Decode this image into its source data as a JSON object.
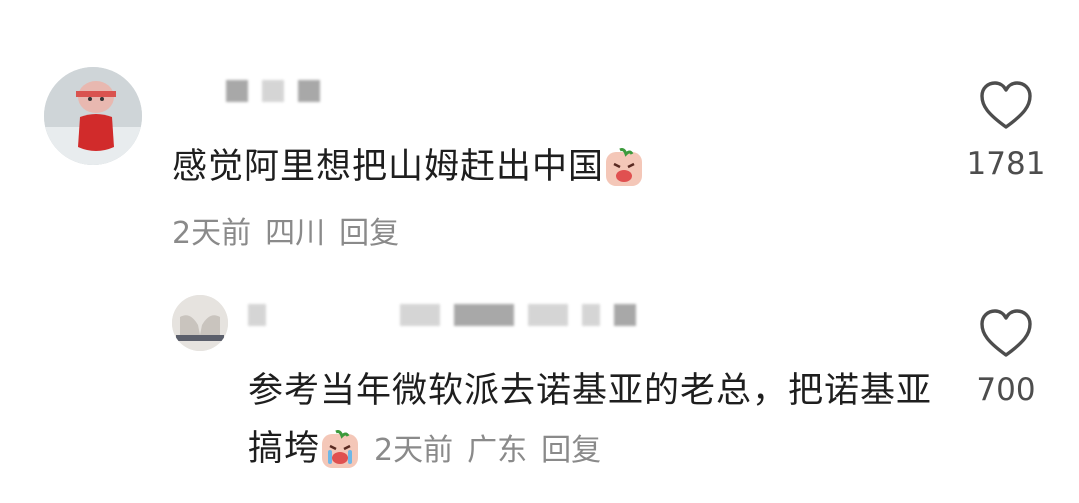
{
  "comments": [
    {
      "text": "感觉阿里想把山姆赶出中国",
      "emoji_icon": "crying-face-icon",
      "time": "2天前",
      "location": "四川",
      "reply_label": "回复",
      "like_count": "1781"
    },
    {
      "text": "参考当年微软派去诺基亚的老总，把诺基亚搞垮",
      "emoji_icon": "crying-face-icon",
      "time": "2天前",
      "location": "广东",
      "reply_label": "回复",
      "like_count": "700"
    }
  ],
  "icons": {
    "like": "heart-outline-icon"
  },
  "colors": {
    "text": "#1e1e1e",
    "meta": "#8a8a8a",
    "count": "#4d4d4d",
    "background": "#ffffff"
  }
}
